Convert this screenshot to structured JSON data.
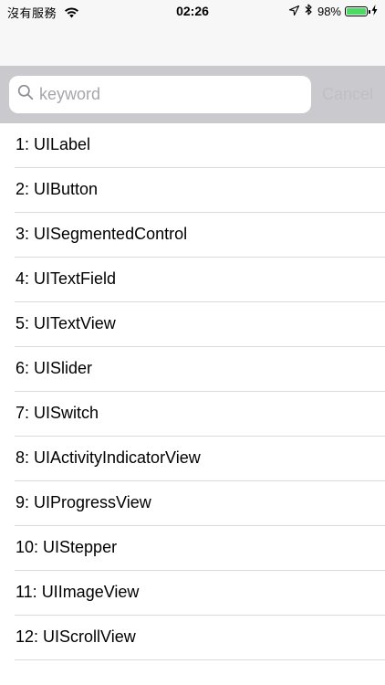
{
  "status_bar": {
    "carrier": "沒有服務",
    "time": "02:26",
    "battery_percent": "98%",
    "battery_level": 0.98,
    "icons": [
      "wifi-icon",
      "location-arrow-icon",
      "bluetooth-icon",
      "battery-icon",
      "charging-bolt-icon"
    ],
    "battery_color": "#4cd964"
  },
  "search": {
    "placeholder": "keyword",
    "value": "",
    "cancel_label": "Cancel",
    "icon": "search-icon"
  },
  "list": {
    "items": [
      {
        "label": "1: UILabel"
      },
      {
        "label": "2: UIButton"
      },
      {
        "label": "3: UISegmentedControl"
      },
      {
        "label": "4: UITextField"
      },
      {
        "label": "5: UITextView"
      },
      {
        "label": "6: UISlider"
      },
      {
        "label": "7: UISwitch"
      },
      {
        "label": "8: UIActivityIndicatorView"
      },
      {
        "label": "9: UIProgressView"
      },
      {
        "label": "10: UIStepper"
      },
      {
        "label": "11: UIImageView"
      },
      {
        "label": "12: UIScrollView"
      }
    ]
  },
  "colors": {
    "search_bar_background": "#c9c9ce",
    "cancel_disabled": "#bfc0c4",
    "separator": "#d9d9dc"
  }
}
